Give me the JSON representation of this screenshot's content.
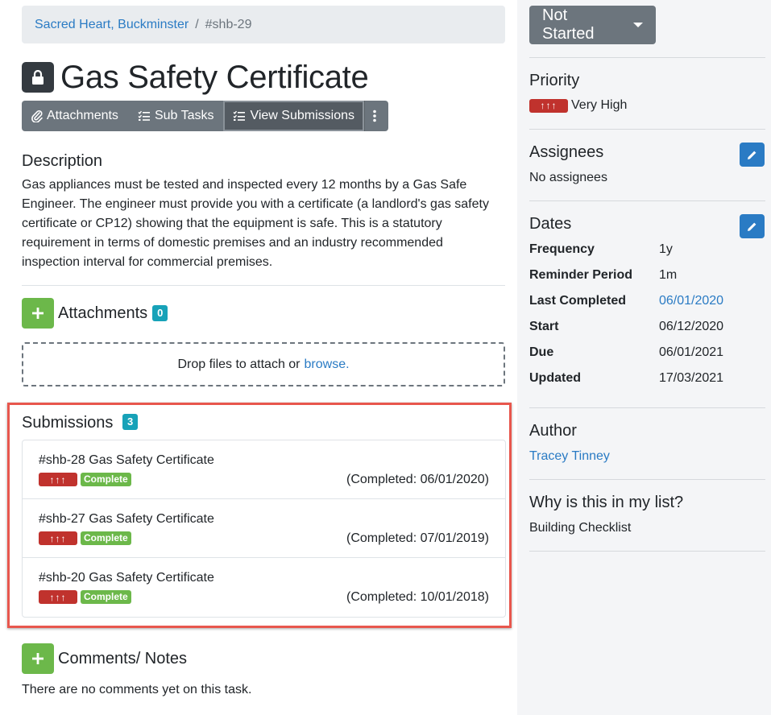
{
  "breadcrumb": {
    "site": "Sacred Heart, Buckminster",
    "separator": "/",
    "current": "#shb-29"
  },
  "task": {
    "title": "Gas Safety Certificate",
    "lock_icon": "lock-icon",
    "tabs": [
      {
        "label": "Attachments",
        "icon": "paperclip-icon"
      },
      {
        "label": "Sub Tasks",
        "icon": "checklist-icon"
      },
      {
        "label": "View Submissions",
        "icon": "checklist-icon",
        "active": true
      }
    ],
    "more_icon": "kebab-menu-icon"
  },
  "description": {
    "heading": "Description",
    "text": "Gas appliances must be tested and inspected every 12 months by a Gas Safe Engineer. The engineer must provide you with a certificate (a landlord's gas safety certificate or CP12) showing that the equipment is safe. This is a statutory requirement in terms of domestic premises and an industry recommended inspection interval for commercial premises."
  },
  "attachments": {
    "heading": "Attachments",
    "count": "0",
    "drop_text": "Drop files to attach or",
    "browse_label": "browse."
  },
  "submissions": {
    "heading": "Submissions",
    "count": "3",
    "items": [
      {
        "name": "#shb-28 Gas Safety Certificate",
        "priority": "↑↑↑",
        "status": "Complete",
        "completed": "(Completed: 06/01/2020)"
      },
      {
        "name": "#shb-27 Gas Safety Certificate",
        "priority": "↑↑↑",
        "status": "Complete",
        "completed": "(Completed: 07/01/2019)"
      },
      {
        "name": "#shb-20 Gas Safety Certificate",
        "priority": "↑↑↑",
        "status": "Complete",
        "completed": "(Completed: 10/01/2018)"
      }
    ],
    "highlight_color": "#e8574d"
  },
  "comments": {
    "heading": "Comments/ Notes",
    "empty_text": "There are no comments yet on this task."
  },
  "sidebar": {
    "status_label": "Not Started",
    "priority": {
      "heading": "Priority",
      "badge": "↑↑↑",
      "label": "Very High"
    },
    "assignees": {
      "heading": "Assignees",
      "empty": "No assignees"
    },
    "dates": {
      "heading": "Dates",
      "rows": [
        {
          "label": "Frequency",
          "value": "1y"
        },
        {
          "label": "Reminder Period",
          "value": "1m"
        },
        {
          "label": "Last Completed",
          "value": "06/01/2020"
        },
        {
          "label": "Start",
          "value": "06/12/2020"
        },
        {
          "label": "Due",
          "value": "06/01/2021"
        },
        {
          "label": "Updated",
          "value": "17/03/2021"
        }
      ]
    },
    "author": {
      "heading": "Author",
      "name": "Tracey Tinney"
    },
    "why": {
      "heading": "Why is this in my list?",
      "reason": "Building Checklist"
    }
  },
  "colors": {
    "primary": "#2a7bc4",
    "success": "#6cb84a",
    "danger": "#c0322d",
    "info": "#17a2b8",
    "secondary": "#6c757d"
  }
}
